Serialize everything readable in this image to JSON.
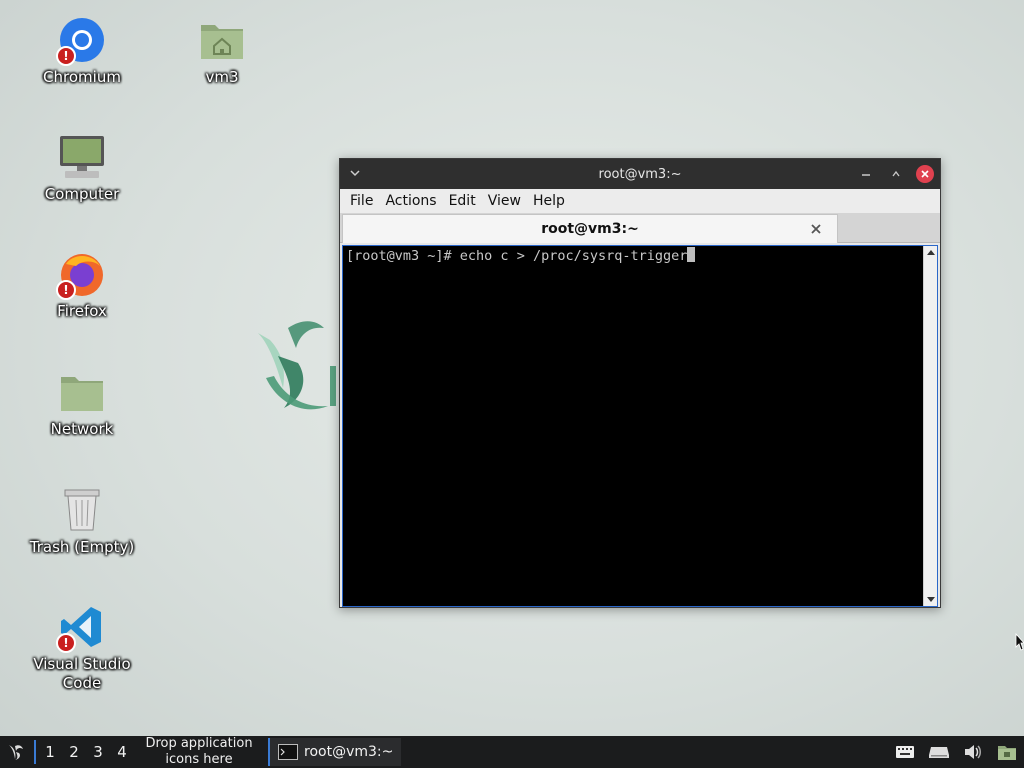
{
  "desktop": {
    "icons": [
      {
        "label": "Chromium",
        "icon": "chromium-icon",
        "badge": "!"
      },
      {
        "label": "vm3",
        "icon": "home-folder-icon"
      },
      {
        "label": "Computer",
        "icon": "computer-icon"
      },
      {
        "label": "Firefox",
        "icon": "firefox-icon",
        "badge": "!"
      },
      {
        "label": "Network",
        "icon": "network-folder-icon"
      },
      {
        "label": "Trash (Empty)",
        "icon": "trash-icon"
      },
      {
        "label": "Visual Studio Code",
        "icon": "vscode-icon",
        "badge": "!"
      }
    ]
  },
  "window": {
    "title": "root@vm3:~",
    "menu": [
      "File",
      "Actions",
      "Edit",
      "View",
      "Help"
    ],
    "tab_label": "root@vm3:~",
    "terminal": {
      "prompt": "[root@vm3 ~]# ",
      "command": "echo c > /proc/sysrq-trigger"
    }
  },
  "taskbar": {
    "workspaces": [
      "1",
      "2",
      "3",
      "4"
    ],
    "drop_hint": "Drop application icons here",
    "task_label": "root@vm3:~",
    "tray_icons": [
      "keyboard-icon",
      "drive-icon",
      "volume-icon",
      "network-icon"
    ]
  },
  "colors": {
    "accent": "#3a7bd5",
    "close": "#e0414f",
    "taskbar": "#1b1c1d",
    "titlebar": "#2f2f2f"
  }
}
